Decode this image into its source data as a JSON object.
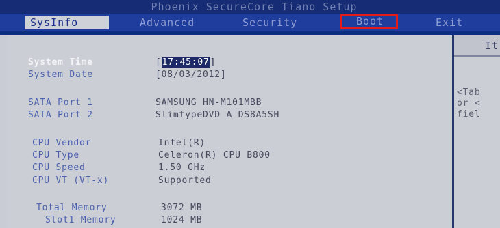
{
  "header": {
    "title": "Phoenix SecureCore Tiano Setup"
  },
  "menu": {
    "items": [
      {
        "label": "SysInfo"
      },
      {
        "label": "Advanced"
      },
      {
        "label": "Security"
      },
      {
        "label": "Boot"
      },
      {
        "label": "Exit"
      }
    ]
  },
  "info": {
    "system_time_label": "System Time",
    "system_time_value": "17:45:07",
    "system_date_label": "System Date",
    "system_date_value": "08/03/2012",
    "sata1_label": "SATA Port 1",
    "sata1_value": "SAMSUNG HN-M101MBB",
    "sata2_label": "SATA Port 2",
    "sata2_value": "SlimtypeDVD A DS8A5SH",
    "cpu_vendor_label": "CPU Vendor",
    "cpu_vendor_value": "Intel(R)",
    "cpu_type_label": "CPU Type",
    "cpu_type_value": "Celeron(R) CPU B800",
    "cpu_speed_label": "CPU Speed",
    "cpu_speed_value": "1.50 GHz",
    "cpu_vt_label": "CPU VT (VT-x)",
    "cpu_vt_value": "Supported",
    "total_memory_label": "Total Memory",
    "total_memory_value": "3072 MB",
    "slot1_memory_label": "Slot1 Memory",
    "slot1_memory_value": "1024 MB"
  },
  "help": {
    "title": "It",
    "line1": "<Tab",
    "line2": "or <",
    "line3": "fiel"
  }
}
